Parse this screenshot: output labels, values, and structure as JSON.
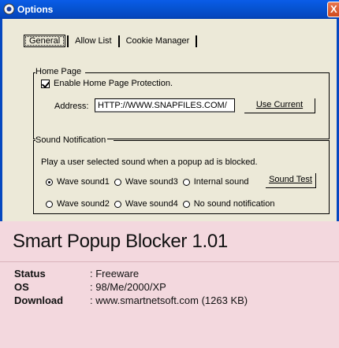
{
  "window": {
    "title": "Options",
    "close_glyph": "X"
  },
  "tabs": [
    {
      "label": "General",
      "active": true
    },
    {
      "label": "Allow List",
      "active": false
    },
    {
      "label": "Cookie Manager",
      "active": false
    }
  ],
  "home_page": {
    "legend": "Home Page",
    "checkbox_label": "Enable Home Page Protection.",
    "checkbox_checked": true,
    "address_label": "Address:",
    "address_value": "HTTP://WWW.SNAPFILES.COM/",
    "use_current_label": "Use Current"
  },
  "sound": {
    "legend": "Sound Notification",
    "description": "Play a user selected sound when a popup ad is blocked.",
    "row1": [
      {
        "label": "Wave sound1",
        "selected": true
      },
      {
        "label": "Wave sound3",
        "selected": false
      },
      {
        "label": "Internal sound",
        "selected": false
      }
    ],
    "row2": [
      {
        "label": "Wave sound2",
        "selected": false
      },
      {
        "label": "Wave sound4",
        "selected": false
      },
      {
        "label": "No sound notification",
        "selected": false
      }
    ],
    "sound_test_label": "Sound Test"
  },
  "card": {
    "title": "Smart Popup Blocker 1.01",
    "specs": [
      {
        "key": "Status",
        "value": ": Freeware"
      },
      {
        "key": "OS",
        "value": ": 98/Me/2000/XP"
      },
      {
        "key": "Download",
        "value": ": www.smartnetsoft.com (1263 KB)"
      }
    ]
  },
  "colors": {
    "titlebar": "#0654d4",
    "dialog_bg": "#ece9d8",
    "card_bg": "#f3d8de"
  }
}
